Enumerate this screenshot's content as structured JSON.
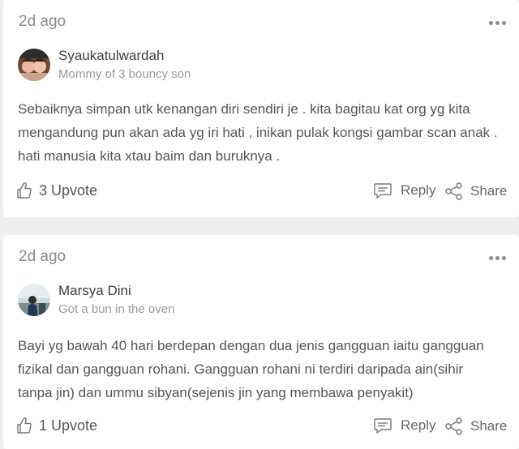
{
  "comments": [
    {
      "timestamp": "2d ago",
      "author": {
        "name": "Syaukatulwardah",
        "tagline": "Mommy of 3 bouncy son"
      },
      "text": "Sebaiknya simpan utk kenangan diri sendiri je . kita bagitau kat org yg kita mengandung pun akan ada yg iri hati , inikan pulak kongsi gambar scan anak . hati manusia kita xtau baim dan buruknya .",
      "upvote_label": "3 Upvote",
      "reply_label": "Reply",
      "share_label": "Share"
    },
    {
      "timestamp": "2d ago",
      "author": {
        "name": "Marsya Dini",
        "tagline": "Got a bun in the oven"
      },
      "text": "Bayi yg bawah 40 hari berdepan dengan dua jenis gangguan iaitu gangguan fizikal dan gangguan rohani. Gangguan rohani ni terdiri daripada ain(sihir tanpa jin) dan ummu sibyan(sejenis jin yang membawa penyakit)",
      "upvote_label": "1 Upvote",
      "reply_label": "Reply",
      "share_label": "Share"
    }
  ],
  "icons": {
    "more": "more-dots-icon",
    "upvote": "thumbs-up-icon",
    "reply": "speech-bubble-icon",
    "share": "share-nodes-icon"
  },
  "colors": {
    "background": "#efefef",
    "card": "#ffffff",
    "muted_text": "#8a8a8a",
    "body_text": "#555555"
  }
}
